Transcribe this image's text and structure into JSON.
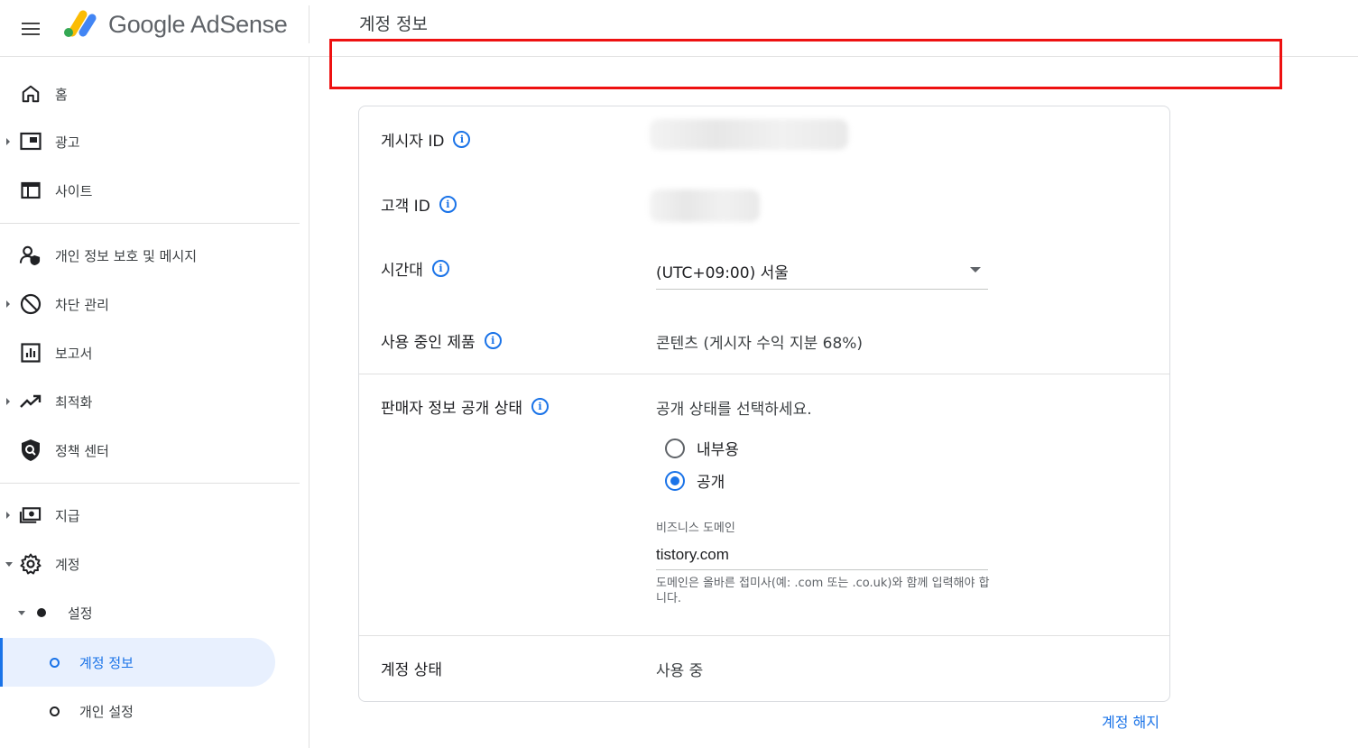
{
  "header": {
    "brand": "Google AdSense",
    "page_title": "계정 정보"
  },
  "sidebar": {
    "items": [
      {
        "label": "홈",
        "icon": "home-icon"
      },
      {
        "label": "광고",
        "icon": "ads-icon"
      },
      {
        "label": "사이트",
        "icon": "sites-icon"
      },
      {
        "label": "개인 정보 보호 및 메시지",
        "icon": "privacy-messaging-icon"
      },
      {
        "label": "차단 관리",
        "icon": "block-icon"
      },
      {
        "label": "보고서",
        "icon": "reports-icon"
      },
      {
        "label": "최적화",
        "icon": "trending-up-icon"
      },
      {
        "label": "정책 센터",
        "icon": "policy-shield-icon"
      },
      {
        "label": "지급",
        "icon": "payments-icon"
      },
      {
        "label": "계정",
        "icon": "gear-icon"
      }
    ],
    "settings_label": "설정",
    "sub_items": [
      {
        "label": "계정 정보"
      },
      {
        "label": "개인 설정"
      }
    ]
  },
  "account_info": {
    "publisher_id_label": "게시자 ID",
    "customer_id_label": "고객 ID",
    "timezone_label": "시간대",
    "timezone_value": "(UTC+09:00) 서울",
    "products_label": "사용 중인 제품",
    "products_value": "콘텐츠 (게시자 수익 지분 68%)",
    "seller_info_label": "판매자 정보 공개 상태",
    "seller_info_prompt": "공개 상태를 선택하세요.",
    "radio_internal": "내부용",
    "radio_public": "공개",
    "selected_visibility": "공개",
    "business_domain_label": "비즈니스 도메인",
    "business_domain_value": "tistory.com",
    "business_domain_help": "도메인은 올바른 접미사(예: .com 또는 .co.uk)와 함께 입력해야 합니다.",
    "account_status_label": "계정 상태",
    "account_status_value": "사용 중"
  },
  "footer": {
    "terminate_link": "계정 해지"
  },
  "colors": {
    "accent": "#1a73e8",
    "highlight": "#ee1111",
    "active_bg": "#e8f0fe"
  }
}
